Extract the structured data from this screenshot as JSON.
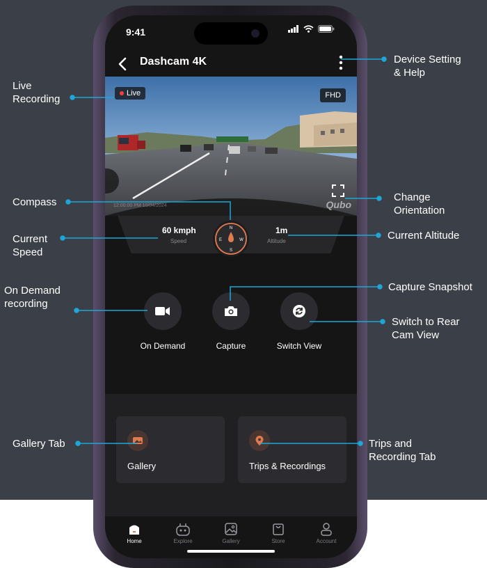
{
  "status_bar": {
    "time": "9:41"
  },
  "header": {
    "title": "Dashcam 4K"
  },
  "video": {
    "live_label": "Live",
    "quality_label": "FHD",
    "timestamp": "12:00:00 PM 10/04/2024",
    "watermark": "Qubo"
  },
  "stats": {
    "speed_value": "60 kmph",
    "speed_label": "Speed",
    "altitude_value": "1m",
    "altitude_label": "Altitude",
    "compass": {
      "n": "N",
      "s": "S",
      "e": "E",
      "w": "W"
    }
  },
  "actions": [
    {
      "label": "On Demand",
      "icon": "video-camera-icon"
    },
    {
      "label": "Capture",
      "icon": "camera-icon"
    },
    {
      "label": "Switch View",
      "icon": "switch-icon"
    }
  ],
  "tiles": [
    {
      "label": "Gallery",
      "icon": "gallery-icon"
    },
    {
      "label": "Trips & Recordings",
      "icon": "location-pin-icon"
    }
  ],
  "nav": [
    {
      "label": "Home",
      "icon": "home-icon",
      "active": true
    },
    {
      "label": "Explore",
      "icon": "robot-icon",
      "active": false
    },
    {
      "label": "Gallery",
      "icon": "image-icon",
      "active": false
    },
    {
      "label": "Store",
      "icon": "bag-icon",
      "active": false
    },
    {
      "label": "Account",
      "icon": "user-icon",
      "active": false
    }
  ],
  "annotations": {
    "device_setting": "Device Setting\n& Help",
    "live_recording": "Live\nRecording",
    "change_orientation": "Change\nOrientation",
    "compass": "Compass",
    "current_speed": "Current\nSpeed",
    "current_altitude": "Current Altitude",
    "capture_snapshot": "Capture Snapshot",
    "on_demand": "On Demand\nrecording",
    "switch_rear": "Switch to Rear\nCam View",
    "gallery_tab": "Gallery Tab",
    "trips_tab": "Trips and\nRecording Tab"
  },
  "colors": {
    "accent": "#e07a4f",
    "leader": "#1fa6d9",
    "background": "#3b3f47"
  }
}
